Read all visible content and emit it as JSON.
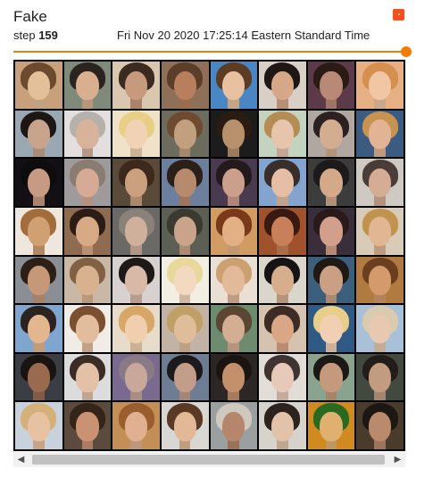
{
  "card": {
    "title": "Fake",
    "step_label": "step",
    "step_value": "159",
    "timestamp": "Fri Nov 20 2020 17:25:14 Eastern Standard Time"
  },
  "slider": {
    "value_fraction": 1.0,
    "accent_color": "#f57c00"
  },
  "corner_icon": {
    "name": "expand-icon",
    "color": "#f4511e"
  },
  "image_grid": {
    "rows": 8,
    "cols": 8,
    "content": "generated face samples",
    "tiles": [
      [
        "#c8a07c",
        "#e3c09a",
        "#6b4a2e"
      ],
      [
        "#7f8a7a",
        "#d9b08f",
        "#2b2320"
      ],
      [
        "#d9c7b0",
        "#c79a7e",
        "#3a2a1f"
      ],
      [
        "#8e7058",
        "#b77f5c",
        "#5a3e2a"
      ],
      [
        "#4b86c4",
        "#e8c2a0",
        "#5c3c25"
      ],
      [
        "#d8cfc6",
        "#d6a888",
        "#1e1715"
      ],
      [
        "#5c3a4a",
        "#b88a75",
        "#2a1b15"
      ],
      [
        "#e6b084",
        "#f0c6a4",
        "#d59050"
      ],
      [
        "#9aa8b4",
        "#c8a48c",
        "#1c1615"
      ],
      [
        "#e2dfde",
        "#d7b39b",
        "#b6b0aa"
      ],
      [
        "#f0e2c9",
        "#f2d2b4",
        "#e8cf86"
      ],
      [
        "#6b6b5e",
        "#c29f7f",
        "#6e4a30"
      ],
      [
        "#1c1c1c",
        "#b8906c",
        "#2a1c12"
      ],
      [
        "#c4d3c0",
        "#e6c5ac",
        "#b58c53"
      ],
      [
        "#b0a8a0",
        "#d2ad90",
        "#2c2020"
      ],
      [
        "#3c5b80",
        "#e2b495",
        "#c89350"
      ],
      [
        "#121015",
        "#c79a84",
        "#0f0c0d"
      ],
      [
        "#9f9a9c",
        "#d6aa95",
        "#8a7c70"
      ],
      [
        "#5a4a3a",
        "#caa07e",
        "#3e2a1c"
      ],
      [
        "#6c7f9c",
        "#b68a6d",
        "#2b1f18"
      ],
      [
        "#4a3a4f",
        "#cc9e8c",
        "#241a1b"
      ],
      [
        "#82a4cf",
        "#e4bfa6",
        "#3a2e2a"
      ],
      [
        "#3c3c3c",
        "#d4a98a",
        "#1c1a1a"
      ],
      [
        "#cfc9c4",
        "#d4ad94",
        "#4a3c36"
      ],
      [
        "#efe7de",
        "#d0a073",
        "#a26c3c"
      ],
      [
        "#8f6b4f",
        "#d8a985",
        "#2b1c15"
      ],
      [
        "#6b6965",
        "#cfb09b",
        "#8a8278"
      ],
      [
        "#5b5f54",
        "#caa48a",
        "#3a3a30"
      ],
      [
        "#d19c61",
        "#e3b085",
        "#7a3a1a"
      ],
      [
        "#a0522d",
        "#c8805a",
        "#3a1a10"
      ],
      [
        "#3b2e3b",
        "#d2a08a",
        "#2a1a1a"
      ],
      [
        "#d8cbb8",
        "#e0b792",
        "#c0934e"
      ],
      [
        "#8a8f95",
        "#c79878",
        "#2b1f16"
      ],
      [
        "#c9b8a6",
        "#d8b28f",
        "#816044"
      ],
      [
        "#d7d2cf",
        "#d8b8a6",
        "#1e1816"
      ],
      [
        "#f2efe2",
        "#f3d9c0",
        "#e8d89a"
      ],
      [
        "#eadfd4",
        "#e2b999",
        "#cda072"
      ],
      [
        "#dad6cc",
        "#d6ae8e",
        "#161314"
      ],
      [
        "#3b5f7c",
        "#caa084",
        "#1f1813"
      ],
      [
        "#b07a40",
        "#d49a6c",
        "#6b3e1f"
      ],
      [
        "#7ea6cf",
        "#e2b78f",
        "#2c2220"
      ],
      [
        "#f1ece6",
        "#e3bc9d",
        "#7a5030"
      ],
      [
        "#e7dcca",
        "#efcfae",
        "#d7a767"
      ],
      [
        "#c2b3a5",
        "#e0bd9a",
        "#c0a066"
      ],
      [
        "#6d8b6f",
        "#d4ae92",
        "#5a4632"
      ],
      [
        "#d5c3b0",
        "#d9a686",
        "#3d2c24"
      ],
      [
        "#2f5a86",
        "#f1cfb2",
        "#e7cf8a"
      ],
      [
        "#a8c0d8",
        "#e7c9b1",
        "#d9cab0"
      ],
      [
        "#3a3d44",
        "#9a6a4e",
        "#1a1410"
      ],
      [
        "#dcdcdc",
        "#e2c1a6",
        "#3b2c25"
      ],
      [
        "#7a6a90",
        "#c9a79a",
        "#8a7a86"
      ],
      [
        "#6e7c94",
        "#c29e8a",
        "#1d1a1c"
      ],
      [
        "#2c2624",
        "#c4906c",
        "#1b1411"
      ],
      [
        "#e3ddd7",
        "#e6c9b8",
        "#403433"
      ],
      [
        "#8aa38f",
        "#c59a7c",
        "#1c1816"
      ],
      [
        "#424a3f",
        "#c29c80",
        "#231d19"
      ],
      [
        "#c8d2dc",
        "#e6c2a2",
        "#d6b07a"
      ],
      [
        "#5a4b3e",
        "#c99272",
        "#352418"
      ],
      [
        "#c38f57",
        "#e0b090",
        "#9a5e2e"
      ],
      [
        "#d9d7d3",
        "#e2b896",
        "#5a3a25"
      ],
      [
        "#9aa0a0",
        "#b5866b",
        "#cfc8bc"
      ],
      [
        "#d6d2cc",
        "#e2c3a9",
        "#2c221e"
      ],
      [
        "#d08a20",
        "#e0b070",
        "#2a6a20"
      ],
      [
        "#4a3c2c",
        "#b98a6c",
        "#1e1814"
      ]
    ]
  },
  "scrollbar": {
    "left_arrow": "◀",
    "right_arrow": "▶"
  }
}
